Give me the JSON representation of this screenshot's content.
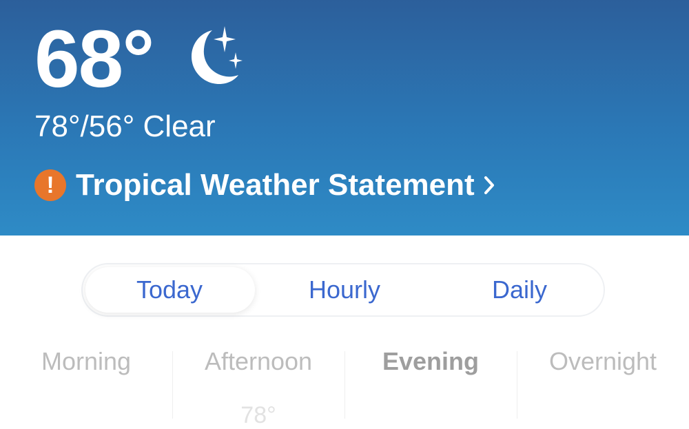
{
  "header": {
    "current_temp": "68°",
    "condition_icon": "moon-stars-icon",
    "hi_lo_condition": "78°/56° Clear",
    "alert": {
      "icon": "exclamation-icon",
      "text": "Tropical Weather Statement",
      "chevron": "chevron-right-icon",
      "color": "#e8762b"
    }
  },
  "tabs": {
    "selected": "Today",
    "items": [
      "Today",
      "Hourly",
      "Daily"
    ],
    "accent": "#3b68cf"
  },
  "day_parts": {
    "selected": "Evening",
    "items": [
      {
        "label": "Morning",
        "temp": ""
      },
      {
        "label": "Afternoon",
        "temp": "78°"
      },
      {
        "label": "Evening",
        "temp": ""
      },
      {
        "label": "Overnight",
        "temp": ""
      }
    ]
  }
}
